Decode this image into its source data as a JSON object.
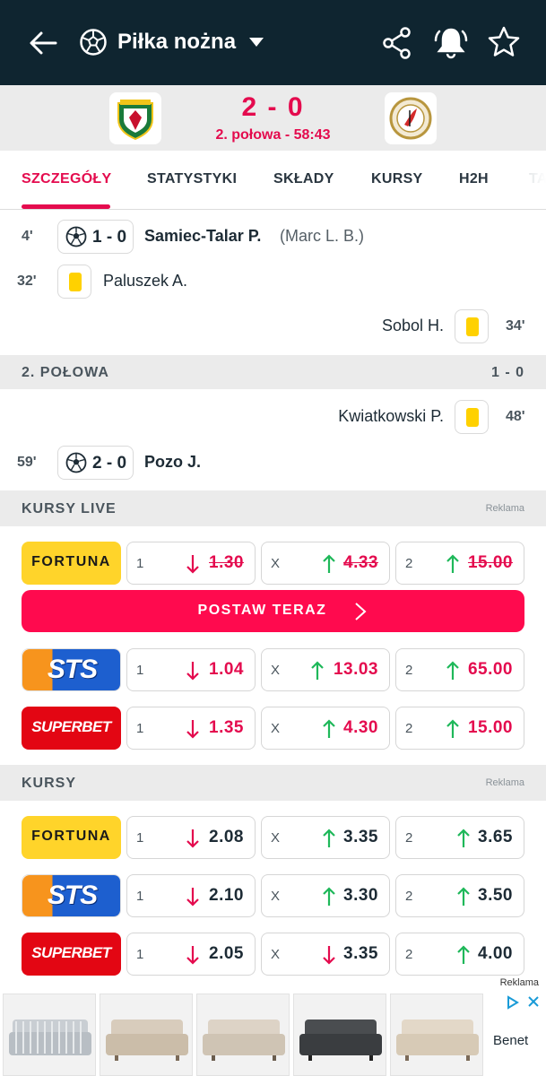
{
  "topbar": {
    "title": "Piłka nożna",
    "icons": [
      "back-arrow-icon",
      "soccer-ball-icon",
      "caret-down-icon",
      "share-icon",
      "bell-icon",
      "star-icon"
    ]
  },
  "match": {
    "score": "2 - 0",
    "status": "2. połowa - 58:43"
  },
  "tabs": [
    {
      "label": "SZCZEGÓŁY",
      "active": true
    },
    {
      "label": "STATYSTYKI"
    },
    {
      "label": "SKŁADY"
    },
    {
      "label": "KURSY"
    },
    {
      "label": "H2H"
    },
    {
      "label": "TA"
    }
  ],
  "events_first_half": [
    {
      "minute": "4'",
      "type": "goal",
      "score": "1 - 0",
      "player": "Samiec-Talar P.",
      "assist": "(Marc L. B.)",
      "side": "home"
    },
    {
      "minute": "32'",
      "type": "yellow",
      "player": "Paluszek A.",
      "side": "home"
    },
    {
      "minute": "34'",
      "type": "yellow",
      "player": "Sobol H.",
      "side": "away"
    }
  ],
  "second_half": {
    "label": "2. POŁOWA",
    "score": "1 - 0",
    "events": [
      {
        "minute": "48'",
        "type": "yellow",
        "player": "Kwiatkowski P.",
        "side": "away"
      },
      {
        "minute": "59'",
        "type": "goal",
        "score": "2 - 0",
        "player": "Pozo J.",
        "side": "home"
      }
    ]
  },
  "live_odds": {
    "label": "KURSY LIVE",
    "ad_label": "Reklama",
    "cta": "POSTAW TERAZ",
    "rows": [
      {
        "bookmaker": "FORTUNA",
        "o1": "1.30",
        "ox": "4.33",
        "o2": "15.00"
      },
      {
        "bookmaker": "STS",
        "o1": "1.04",
        "ox": "13.03",
        "o2": "65.00"
      },
      {
        "bookmaker": "SUPERBET",
        "o1": "1.35",
        "ox": "4.30",
        "o2": "15.00"
      }
    ]
  },
  "odds": {
    "label": "KURSY",
    "ad_label": "Reklama",
    "rows": [
      {
        "bookmaker": "FORTUNA",
        "o1": "2.08",
        "ox": "3.35",
        "o2": "3.65"
      },
      {
        "bookmaker": "STS",
        "o1": "2.10",
        "ox": "3.30",
        "o2": "3.50"
      },
      {
        "bookmaker": "SUPERBET",
        "o1": "2.05",
        "ox": "3.35",
        "o2": "4.00"
      }
    ]
  },
  "odd_keys": {
    "one": "1",
    "draw": "X",
    "two": "2"
  },
  "ad_strip": {
    "label": "Reklama",
    "brand": "Benet"
  },
  "colors": {
    "topbar": "#0f2530",
    "accent": "#e40b4e",
    "up": "#1fb85a",
    "down": "#e40b4e",
    "yellow_card": "#ffd100"
  }
}
